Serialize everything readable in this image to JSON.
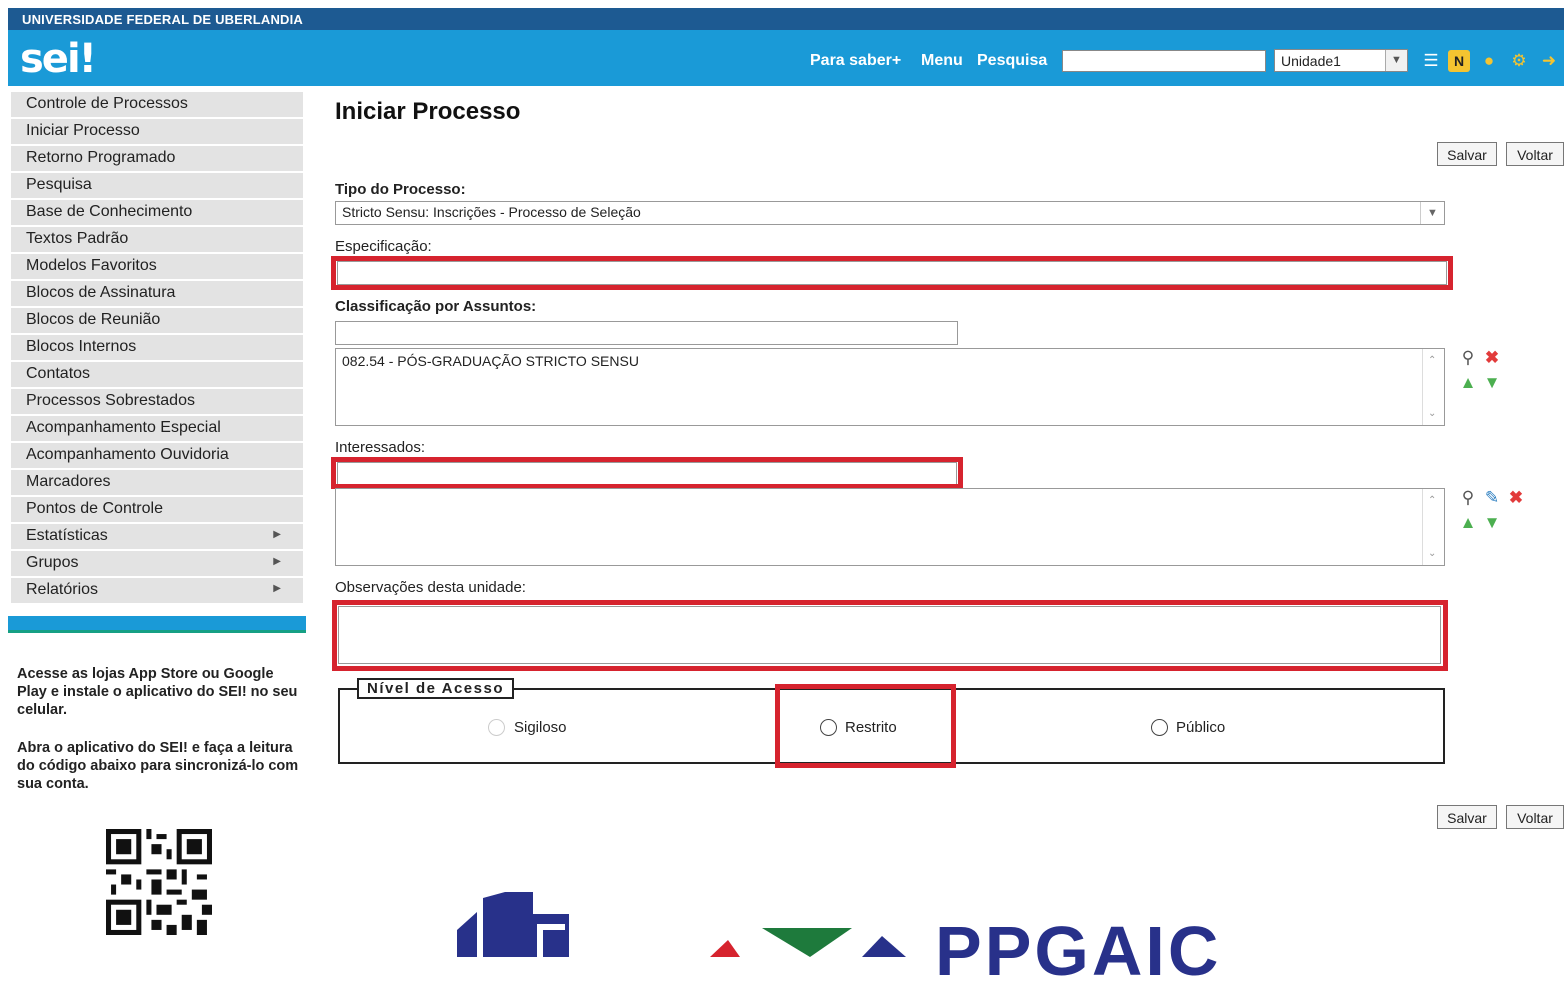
{
  "header": {
    "institution": "UNIVERSIDADE FEDERAL DE UBERLANDIA",
    "logo": "sei!",
    "links": [
      "Para saber+",
      "Menu",
      "Pesquisa"
    ],
    "search_value": "",
    "unit": "Unidade1",
    "icons": [
      "grid-icon",
      "notification-icon",
      "user-icon",
      "wrench-icon",
      "exit-icon"
    ],
    "colors": {
      "top": "#1d5a92",
      "bar": "#1a9ad7"
    }
  },
  "sidebar": {
    "items": [
      {
        "label": "Controle de Processos"
      },
      {
        "label": "Iniciar Processo"
      },
      {
        "label": "Retorno Programado"
      },
      {
        "label": "Pesquisa"
      },
      {
        "label": "Base de Conhecimento"
      },
      {
        "label": "Textos Padrão"
      },
      {
        "label": "Modelos Favoritos"
      },
      {
        "label": "Blocos de Assinatura"
      },
      {
        "label": "Blocos de Reunião"
      },
      {
        "label": "Blocos Internos"
      },
      {
        "label": "Contatos"
      },
      {
        "label": "Processos Sobrestados"
      },
      {
        "label": "Acompanhamento Especial"
      },
      {
        "label": "Acompanhamento Ouvidoria"
      },
      {
        "label": "Marcadores"
      },
      {
        "label": "Pontos de Controle"
      },
      {
        "label": "Estatísticas",
        "submenu": true
      },
      {
        "label": "Grupos",
        "submenu": true
      },
      {
        "label": "Relatórios",
        "submenu": true
      }
    ],
    "app_text_1": "Acesse as lojas App Store ou Google Play e instale o aplicativo do SEI! no seu celular.",
    "app_text_2": "Abra o aplicativo do SEI! e faça a leitura do código abaixo para sincronizá-lo com sua conta."
  },
  "main": {
    "title": "Iniciar Processo",
    "buttons": {
      "save": "Salvar",
      "back": "Voltar"
    },
    "tipo_label": "Tipo do Processo:",
    "tipo_value": "Stricto Sensu: Inscrições - Processo de Seleção",
    "especificacao_label": "Especificação:",
    "especificacao_value": "",
    "classificacao_label": "Classificação por Assuntos:",
    "classificacao_input": "",
    "classificacao_list": [
      "082.54 - PÓS-GRADUAÇÃO STRICTO SENSU"
    ],
    "interessados_label": "Interessados:",
    "interessados_input": "",
    "observacoes_label": "Observações desta unidade:",
    "observacoes_value": "",
    "nivel_legend": "Nível de Acesso",
    "nivel_options": [
      "Sigiloso",
      "Restrito",
      "Público"
    ],
    "highlight_color": "#d6232e"
  },
  "footer_logos": {
    "ppgaic_text": "PPGAIC"
  }
}
